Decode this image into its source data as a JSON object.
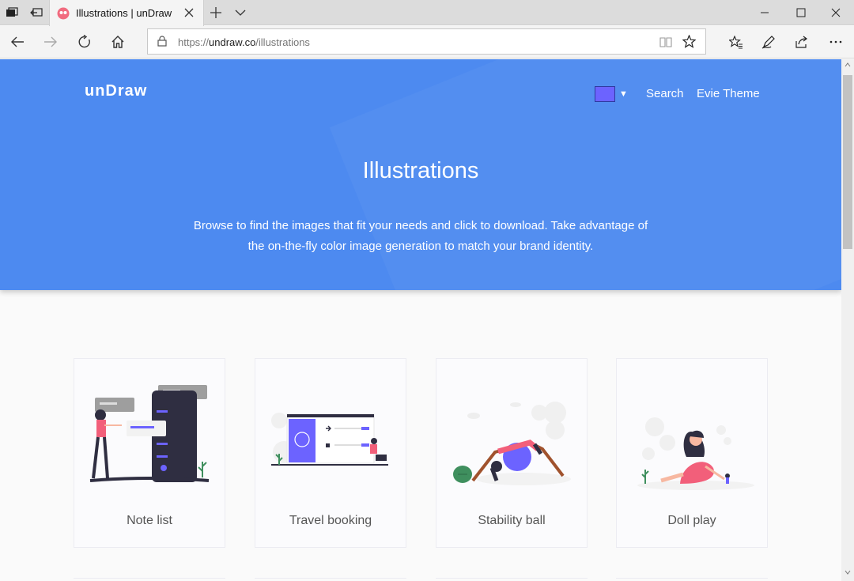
{
  "browser": {
    "tab_title": "Illustrations | unDraw",
    "url_prefix": "https://",
    "url_domain": "undraw.co",
    "url_path": "/illustrations"
  },
  "header": {
    "logo": "unDraw",
    "color_swatch": "#6c63ff",
    "caret": "▼",
    "nav": {
      "search": "Search",
      "evie": "Evie Theme"
    }
  },
  "hero": {
    "title": "Illustrations",
    "description_line1": "Browse to find the images that fit your needs and click to download. Take advantage of",
    "description_line2": "the on-the-fly color image generation to match your brand identity."
  },
  "cards": [
    {
      "label": "Note list"
    },
    {
      "label": "Travel booking"
    },
    {
      "label": "Stability ball"
    },
    {
      "label": "Doll play"
    }
  ],
  "colors": {
    "hero": "#4d8af0",
    "accent": "#6c63ff",
    "figure": "#f25f7a",
    "dark": "#2f2e41"
  }
}
